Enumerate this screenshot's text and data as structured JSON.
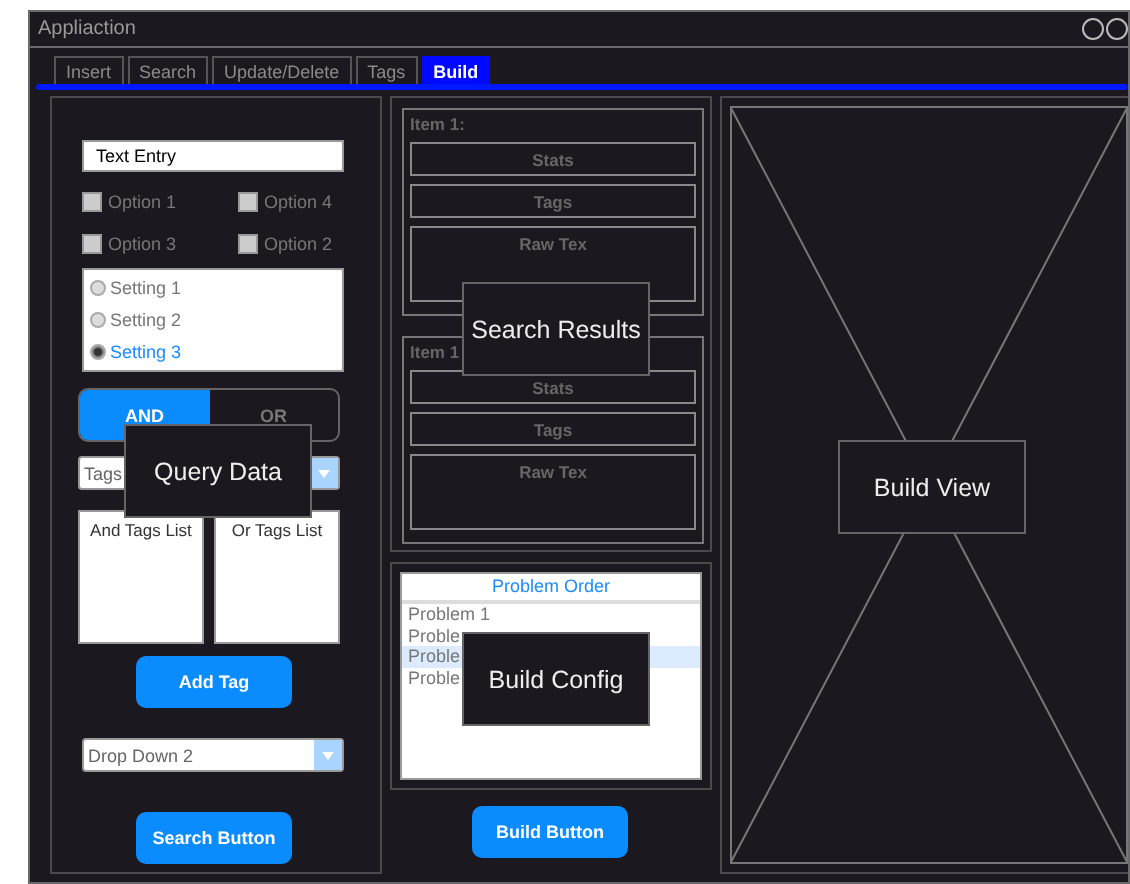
{
  "window": {
    "title": "Appliaction"
  },
  "tabs": [
    {
      "label": "Insert",
      "selected": false
    },
    {
      "label": "Search",
      "selected": false
    },
    {
      "label": "Update/Delete",
      "selected": false
    },
    {
      "label": "Tags",
      "selected": false
    },
    {
      "label": "Build",
      "selected": true
    }
  ],
  "query": {
    "text_entry": {
      "value": "Text Entry"
    },
    "options": [
      {
        "label": "Option 1",
        "checked": false
      },
      {
        "label": "Option 4",
        "checked": false
      },
      {
        "label": "Option 3",
        "checked": false
      },
      {
        "label": "Option 2",
        "checked": false
      }
    ],
    "settings": [
      {
        "label": "Setting 1",
        "selected": false
      },
      {
        "label": "Setting 2",
        "selected": false
      },
      {
        "label": "Setting 3",
        "selected": true
      }
    ],
    "logic": [
      {
        "label": "AND",
        "selected": true
      },
      {
        "label": "OR",
        "selected": false
      }
    ],
    "tags_dropdown": {
      "value": "Tags"
    },
    "tag_lists": [
      "And Tags List",
      "Or Tags List"
    ],
    "add_tag_button": "Add Tag",
    "dropdown_2": {
      "value": "Drop Down 2"
    },
    "search_button": "Search Button"
  },
  "results": [
    {
      "title": "Item 1:",
      "fields": [
        "Stats",
        "Tags",
        "Raw Tex"
      ]
    },
    {
      "title": "Item 1",
      "fields": [
        "Stats",
        "Tags",
        "Raw Tex"
      ]
    }
  ],
  "build_config": {
    "header": "Problem Order",
    "problems": [
      {
        "label": "Problem 1",
        "selected": false
      },
      {
        "label": "Proble",
        "selected": false
      },
      {
        "label": "Proble",
        "selected": true
      },
      {
        "label": "Proble",
        "selected": false
      }
    ],
    "build_button": "Build Button"
  },
  "overlays": {
    "query": "Query Data",
    "results": "Search Results",
    "config": "Build Config",
    "view": "Build View"
  }
}
